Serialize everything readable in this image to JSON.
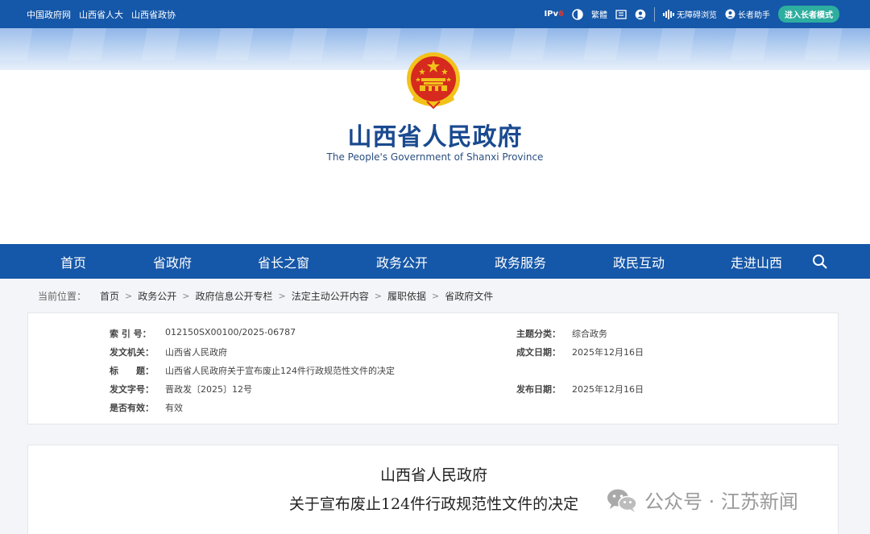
{
  "topbar": {
    "links": [
      "中国政府网",
      "山西省人大",
      "山西省政协"
    ],
    "ipv6": {
      "prefix": "IPv",
      "suffix": "6"
    },
    "tools": {
      "traditional": "繁體",
      "barrier_free": "无障碍浏览",
      "governor_assistant": "长者助手",
      "elder_mode": "进入长者模式"
    }
  },
  "header": {
    "title": "山西省人民政府",
    "subtitle": "The People's Government of Shanxi Province"
  },
  "nav": {
    "items": [
      "首页",
      "省政府",
      "省长之窗",
      "政务公开",
      "政务服务",
      "政民互动",
      "走进山西"
    ]
  },
  "breadcrumb": {
    "label": "当前位置：",
    "items": [
      "首页",
      "政务公开",
      "政府信息公开专栏",
      "法定主动公开内容",
      "履职依据",
      "省政府文件"
    ]
  },
  "info": {
    "index_key": "索 引 号：",
    "index_val": "012150SX00100/2025-06787",
    "topic_key": "主题分类：",
    "topic_val": "综合政务",
    "issuer_key": "发文机关：",
    "issuer_val": "山西省人民政府",
    "made_key": "成文日期：",
    "made_val": "2025年12月16日",
    "title_key": "标　　题：",
    "title_val": "山西省人民政府关于宣布废止124件行政规范性文件的决定",
    "docno_key": "发文字号：",
    "docno_val": "晋政发〔2025〕12号",
    "pub_key": "发布日期：",
    "pub_val": "2025年12月16日",
    "valid_key": "是否有效：",
    "valid_val": "有效"
  },
  "content": {
    "issuer": "山西省人民政府",
    "title": "关于宣布废止124件行政规范性文件的决定"
  },
  "watermark": {
    "text": "公众号 · 江苏新闻"
  },
  "colors": {
    "brand_blue": "#1557a8",
    "title_blue": "#1a4a8f",
    "elder_green": "#2dae9f",
    "emblem_red": "#d62a1e",
    "emblem_gold": "#f2c21b"
  }
}
